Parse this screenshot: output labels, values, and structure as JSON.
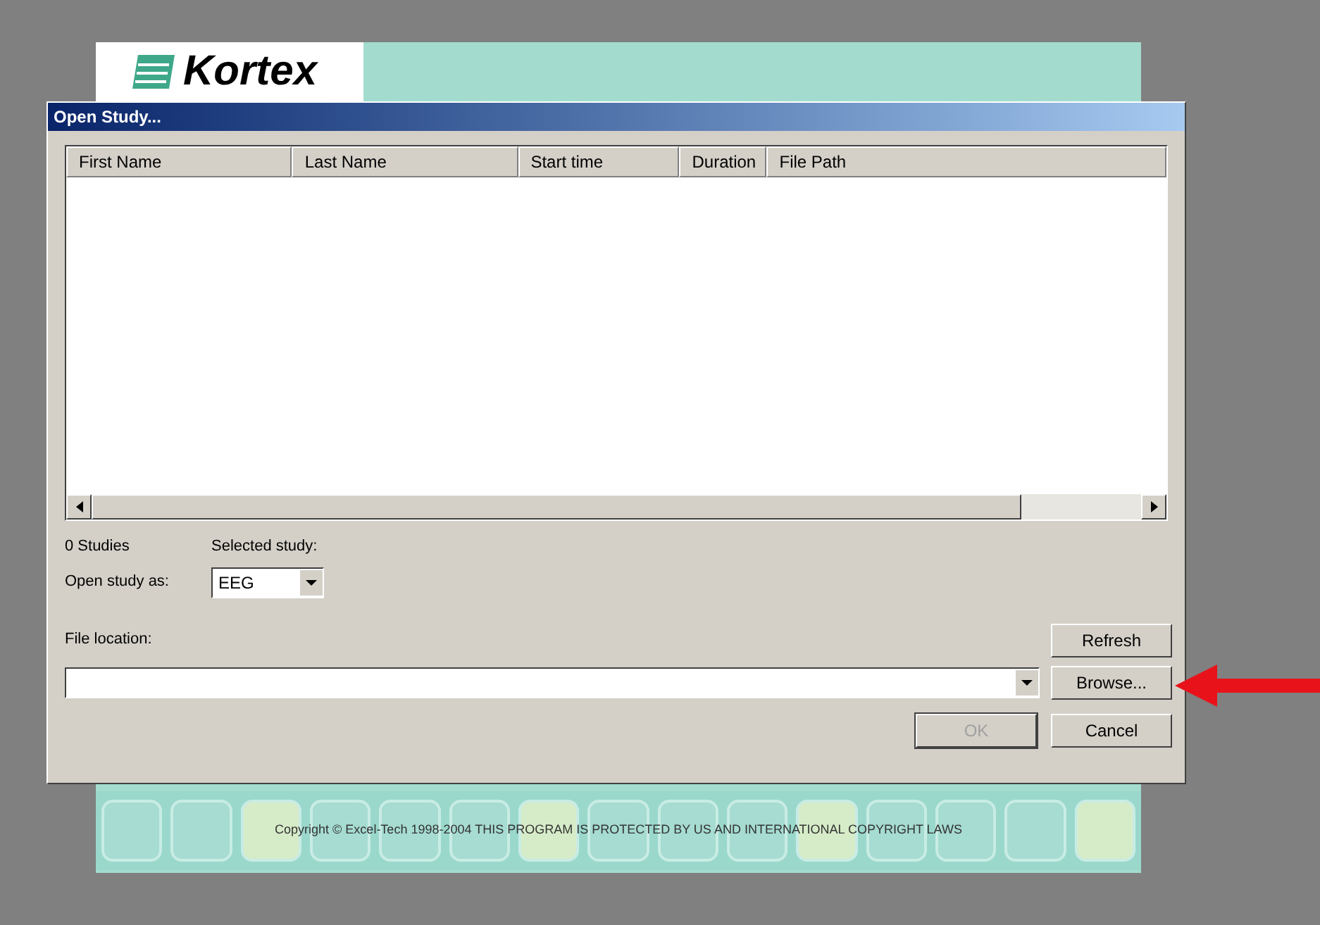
{
  "splash": {
    "logo": "Kortex",
    "copyright": "Copyright © Excel-Tech 1998-2004 THIS PROGRAM IS PROTECTED BY US AND INTERNATIONAL COPYRIGHT LAWS"
  },
  "dialog": {
    "title": "Open Study...",
    "columns": [
      "First Name",
      "Last Name",
      "Start time",
      "Duration",
      "File Path"
    ],
    "study_count": "0 Studies",
    "selected_study_label": "Selected study:",
    "open_as_label": "Open study as:",
    "open_as_value": "EEG",
    "file_location_label": "File location:",
    "buttons": [
      {
        "label": "Refresh",
        "disabled": false
      },
      {
        "label": "Browse...",
        "disabled": false
      },
      {
        "label": "OK",
        "disabled": true
      },
      {
        "label": "Cancel",
        "disabled": false
      }
    ]
  },
  "annotation": {
    "arrow_shown": true
  }
}
